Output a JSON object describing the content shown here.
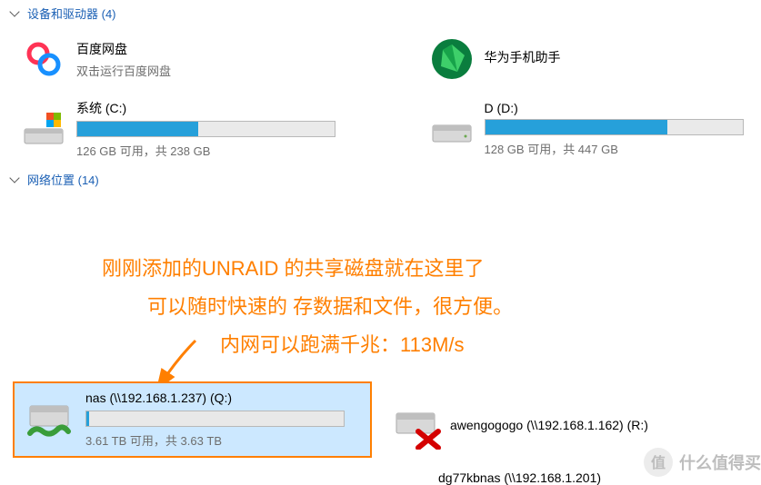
{
  "sections": {
    "devices": {
      "title": "设备和驱动器 (4)",
      "items": [
        {
          "name": "百度网盘",
          "sub": "双击运行百度网盘"
        },
        {
          "name": "华为手机助手",
          "sub": ""
        }
      ],
      "drives": [
        {
          "name": "系统 (C:)",
          "usage_text": "126 GB 可用，共 238 GB",
          "fill_percent": 47
        },
        {
          "name": "D (D:)",
          "usage_text": "128 GB 可用，共 447 GB",
          "fill_percent": 71
        }
      ]
    },
    "network": {
      "title": "网络位置 (14)",
      "annotation": {
        "line1": "刚刚添加的UNRAID 的共享磁盘就在这里了",
        "line2": "可以随时快速的 存数据和文件，很方便。",
        "line3": "内网可以跑满千兆：113M/s"
      },
      "items": [
        {
          "name": "nas (\\\\192.168.1.237) (Q:)",
          "usage_text": "3.61 TB 可用，共 3.63 TB",
          "fill_percent": 1
        },
        {
          "name": "awengogogo (\\\\192.168.1.162) (R:)",
          "disconnected": true
        }
      ],
      "partial_item": "dg77kbnas (\\\\192.168.1.201)"
    }
  },
  "watermark": "什么值得买"
}
